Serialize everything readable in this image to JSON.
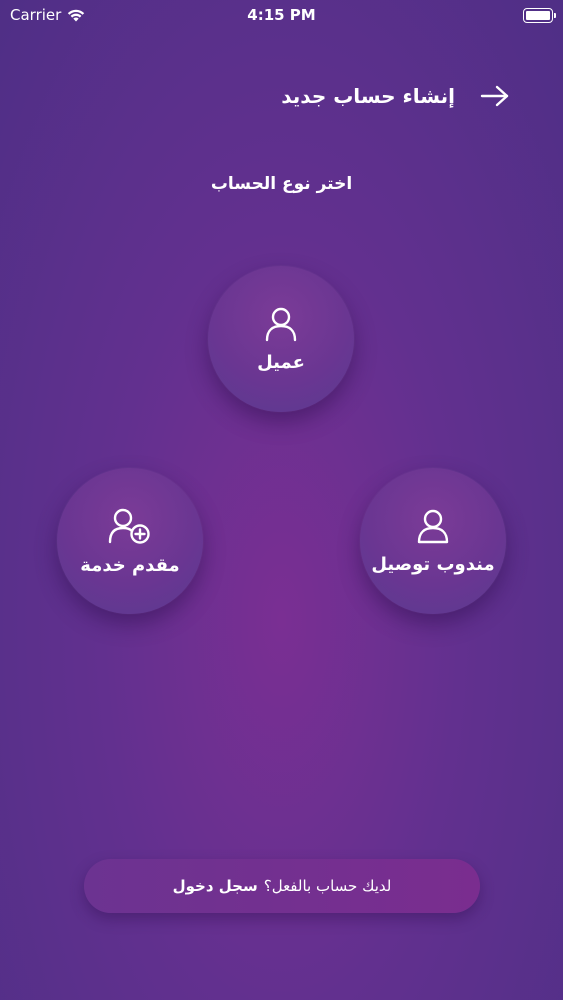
{
  "status_bar": {
    "carrier": "Carrier",
    "time": "4:15 PM"
  },
  "header": {
    "title": "إنشاء حساب جديد",
    "back_icon": "arrow-right-icon"
  },
  "subtitle": "اختر نوع الحساب",
  "account_types": {
    "client": {
      "label": "عميل",
      "icon": "user-icon"
    },
    "provider": {
      "label": "مقدم خدمة",
      "icon": "user-add-icon"
    },
    "delivery": {
      "label": "مندوب توصيل",
      "icon": "user-icon"
    }
  },
  "login": {
    "question": "لديك حساب بالفعل؟",
    "action": "سجل دخول"
  },
  "colors": {
    "background": "#62308f",
    "circle": "#6a3692",
    "pill": "#7a2d8f"
  }
}
